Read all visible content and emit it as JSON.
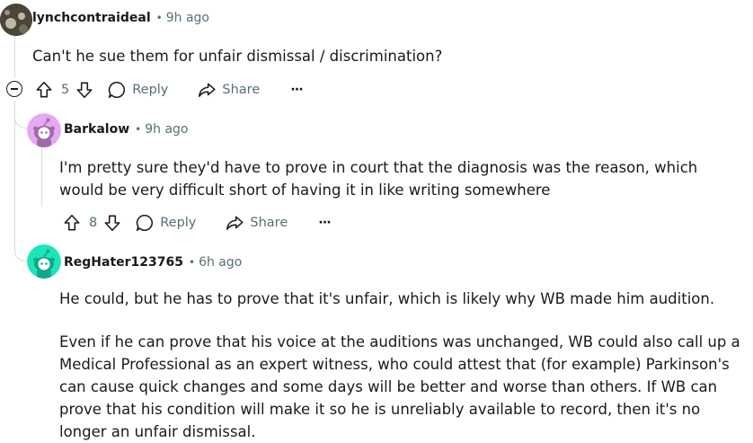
{
  "comments": [
    {
      "author": "lynchcontraideal",
      "separator": "•",
      "time": "9h ago",
      "body": [
        "Can't he sue them for unfair dismissal / discrimination?"
      ],
      "votes": "5",
      "reply_label": "Reply",
      "share_label": "Share",
      "more_label": "···"
    },
    {
      "author": "Barkalow",
      "separator": "•",
      "time": "9h ago",
      "body": [
        "I'm pretty sure they'd have to prove in court that the diagnosis was the reason, which would be very difficult short of having it in like writing somewhere"
      ],
      "votes": "8",
      "reply_label": "Reply",
      "share_label": "Share",
      "more_label": "···",
      "avatar_color": "#e4a9f0"
    },
    {
      "author": "RegHater123765",
      "separator": "•",
      "time": "6h ago",
      "body": [
        "He could, but he has to prove that it's unfair, which is likely why WB made him audition.",
        "Even if he can prove that his voice at the auditions was unchanged, WB could also call up a Medical Professional as an expert witness, who could attest that (for example) Parkinson's can cause quick changes and some days will be better and worse than others. If WB can prove that his condition will make it so he is unreliably available to record, then it's no longer an unfair dismissal."
      ],
      "avatar_color": "#1ee5b9"
    }
  ]
}
